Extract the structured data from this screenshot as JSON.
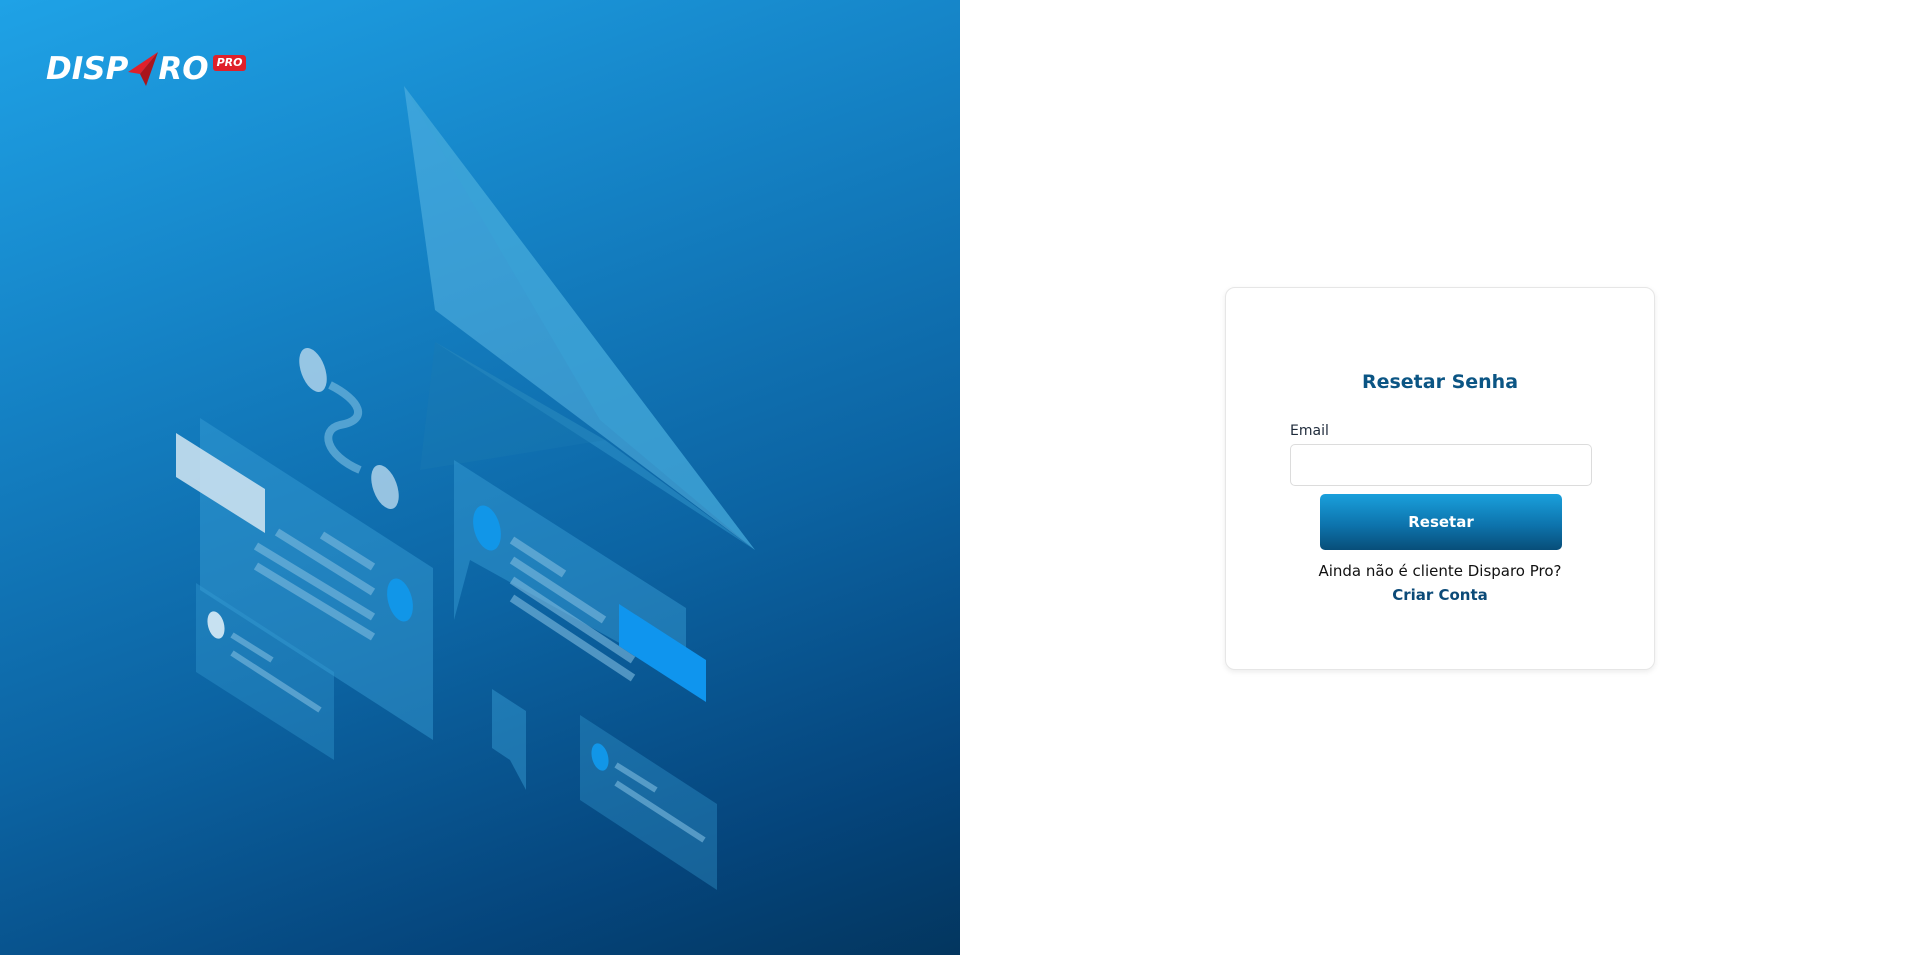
{
  "brand": {
    "logo_text_left": "DISP",
    "logo_text_right": "RO",
    "logo_badge": "PRO",
    "logo_icon": "paper-plane-icon"
  },
  "reset_form": {
    "title": "Resetar Senha",
    "email_label": "Email",
    "email_value": "",
    "email_placeholder": "",
    "submit_label": "Resetar",
    "signup_prompt": "Ainda não é cliente Disparo Pro?",
    "signup_link": "Criar Conta"
  },
  "colors": {
    "brand_blue": "#0b5584",
    "accent_red": "#e0202a",
    "hero_gradient_start": "#1fa2e6",
    "hero_gradient_end": "#03365f",
    "button_gradient_start": "#1aa0dc",
    "button_gradient_end": "#084e79"
  }
}
